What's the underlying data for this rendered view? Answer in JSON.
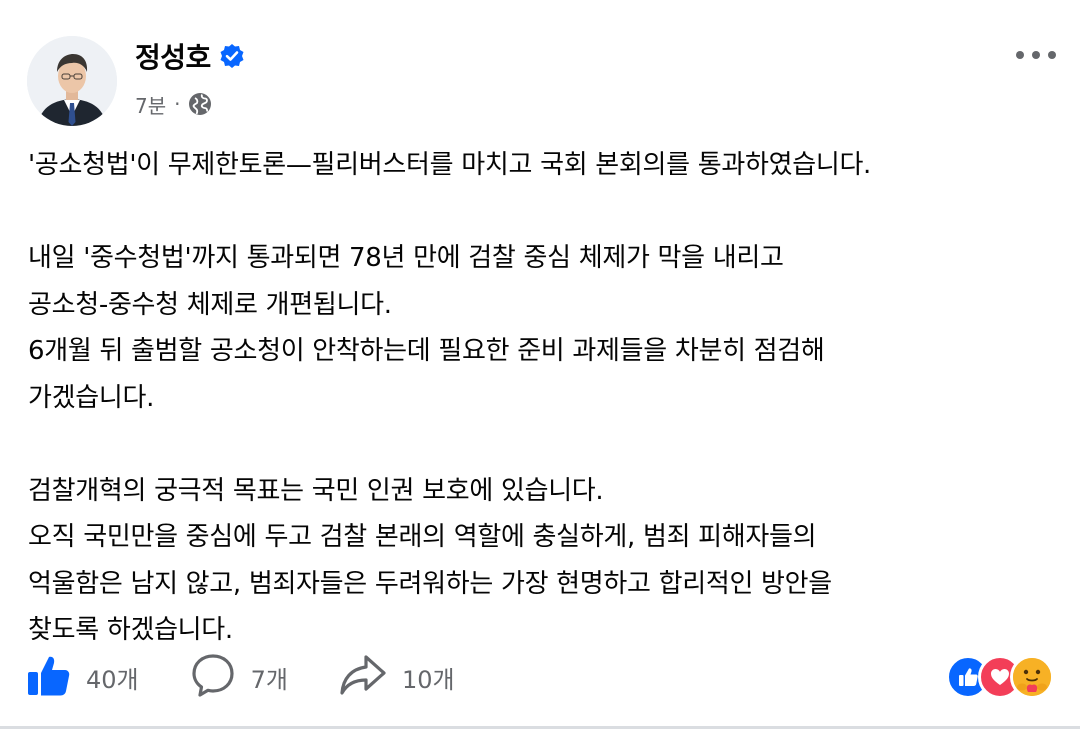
{
  "author": {
    "name": "정성호",
    "verified": true
  },
  "meta": {
    "time": "7분",
    "separator": "·",
    "audience_icon": "globe-icon"
  },
  "post": {
    "paragraphs": [
      [
        "'공소청법'이 무제한토론—필리버스터를 마치고 국회 본회의를 통과하였습니다."
      ],
      [
        "내일 '중수청법'까지 통과되면 78년 만에 검찰 중심 체제가 막을 내리고",
        "공소청-중수청 체제로 개편됩니다.",
        "6개월 뒤 출범할 공소청이 안착하는데 필요한 준비 과제들을 차분히 점검해",
        "가겠습니다."
      ],
      [
        "검찰개혁의 궁극적 목표는 국민 인권 보호에 있습니다.",
        "오직 국민만을 중심에 두고 검찰 본래의 역할에 충실하게, 범죄 피해자들의",
        "억울함은 남지 않고, 범죄자들은 두려워하는 가장 현명하고 합리적인 방안을",
        "찾도록 하겠습니다."
      ]
    ]
  },
  "actions": {
    "like_count": "40개",
    "comment_count": "7개",
    "share_count": "10개"
  },
  "reactions": [
    "like-icon",
    "love-icon",
    "care-icon"
  ],
  "colors": {
    "facebook_blue": "#0866ff",
    "verified_blue": "#0866ff",
    "secondary_text": "#65676b",
    "love_red": "#f33e58",
    "care_yellow": "#f7b125"
  }
}
